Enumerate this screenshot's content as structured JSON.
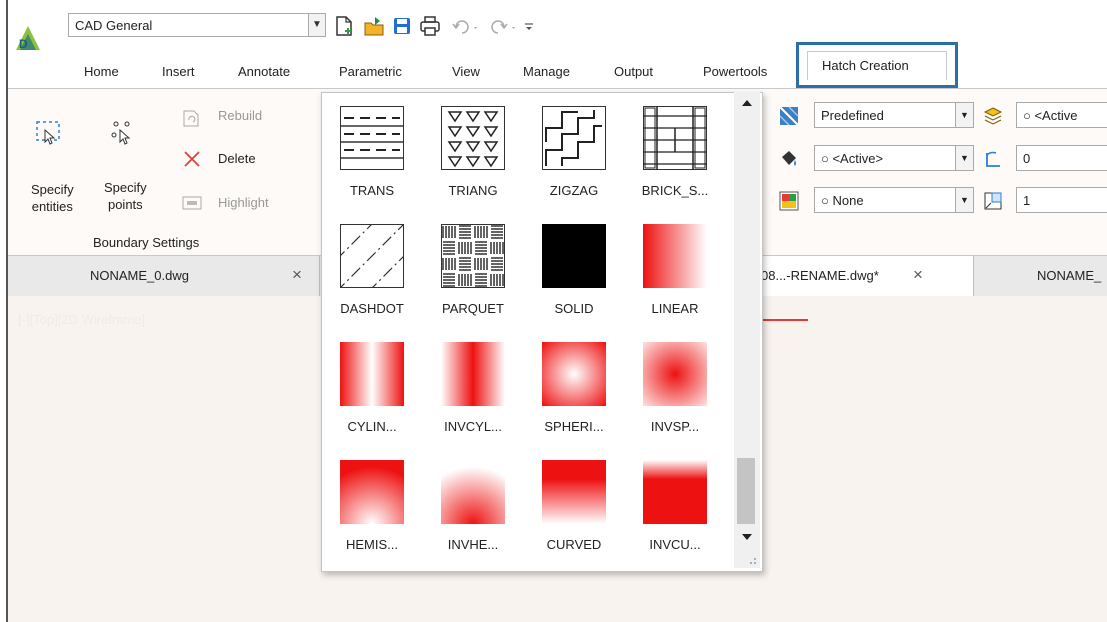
{
  "quick_access": {
    "workspace": "CAD General",
    "icons": [
      "new-file-icon",
      "open-file-icon",
      "save-icon",
      "print-icon",
      "undo-icon",
      "redo-icon",
      "customize-icon"
    ]
  },
  "tabs": [
    "Home",
    "Insert",
    "Annotate",
    "Parametric",
    "View",
    "Manage",
    "Output",
    "Powertools",
    "Hatch Creation"
  ],
  "boundary": {
    "specify_entities_1": "Specify",
    "specify_entities_2": "entities",
    "specify_points_1": "Specify",
    "specify_points_2": "points",
    "rebuild": "Rebuild",
    "delete": "Delete",
    "highlight": "Highlight",
    "panel_title": "Boundary Settings"
  },
  "patterns": [
    {
      "name": "TRANS",
      "kind": "trans"
    },
    {
      "name": "TRIANG",
      "kind": "triang"
    },
    {
      "name": "ZIGZAG",
      "kind": "zigzag"
    },
    {
      "name": "BRICK_S...",
      "kind": "brick"
    },
    {
      "name": "DASHDOT",
      "kind": "dashdot"
    },
    {
      "name": "PARQUET",
      "kind": "parquet"
    },
    {
      "name": "SOLID",
      "kind": "solid"
    },
    {
      "name": "LINEAR",
      "kind": "linear"
    },
    {
      "name": "CYLIN...",
      "kind": "cylin"
    },
    {
      "name": "INVCYL...",
      "kind": "invcyl"
    },
    {
      "name": "SPHERI...",
      "kind": "spheri"
    },
    {
      "name": "INVSP...",
      "kind": "invsp"
    },
    {
      "name": "HEMIS...",
      "kind": "hemis"
    },
    {
      "name": "INVHE...",
      "kind": "invhe"
    },
    {
      "name": "CURVED",
      "kind": "curved"
    },
    {
      "name": "INVCU...",
      "kind": "invcu"
    }
  ],
  "properties": {
    "pattern_type": "Predefined",
    "layer": "<Active",
    "color": "<Active>",
    "angle": "0",
    "background": "None",
    "scale": "1"
  },
  "doc_tabs": {
    "tab1": "NONAME_0.dwg",
    "tab2": "08...-RENAME.dwg*",
    "tab3": "NONAME_",
    "close": "×"
  },
  "viewport_label": "[-][Top][2D Wireframe]",
  "colors": {
    "accent": "#2c6ea8",
    "gradient": "#ee1111",
    "canvas": "#f8f3ef"
  }
}
